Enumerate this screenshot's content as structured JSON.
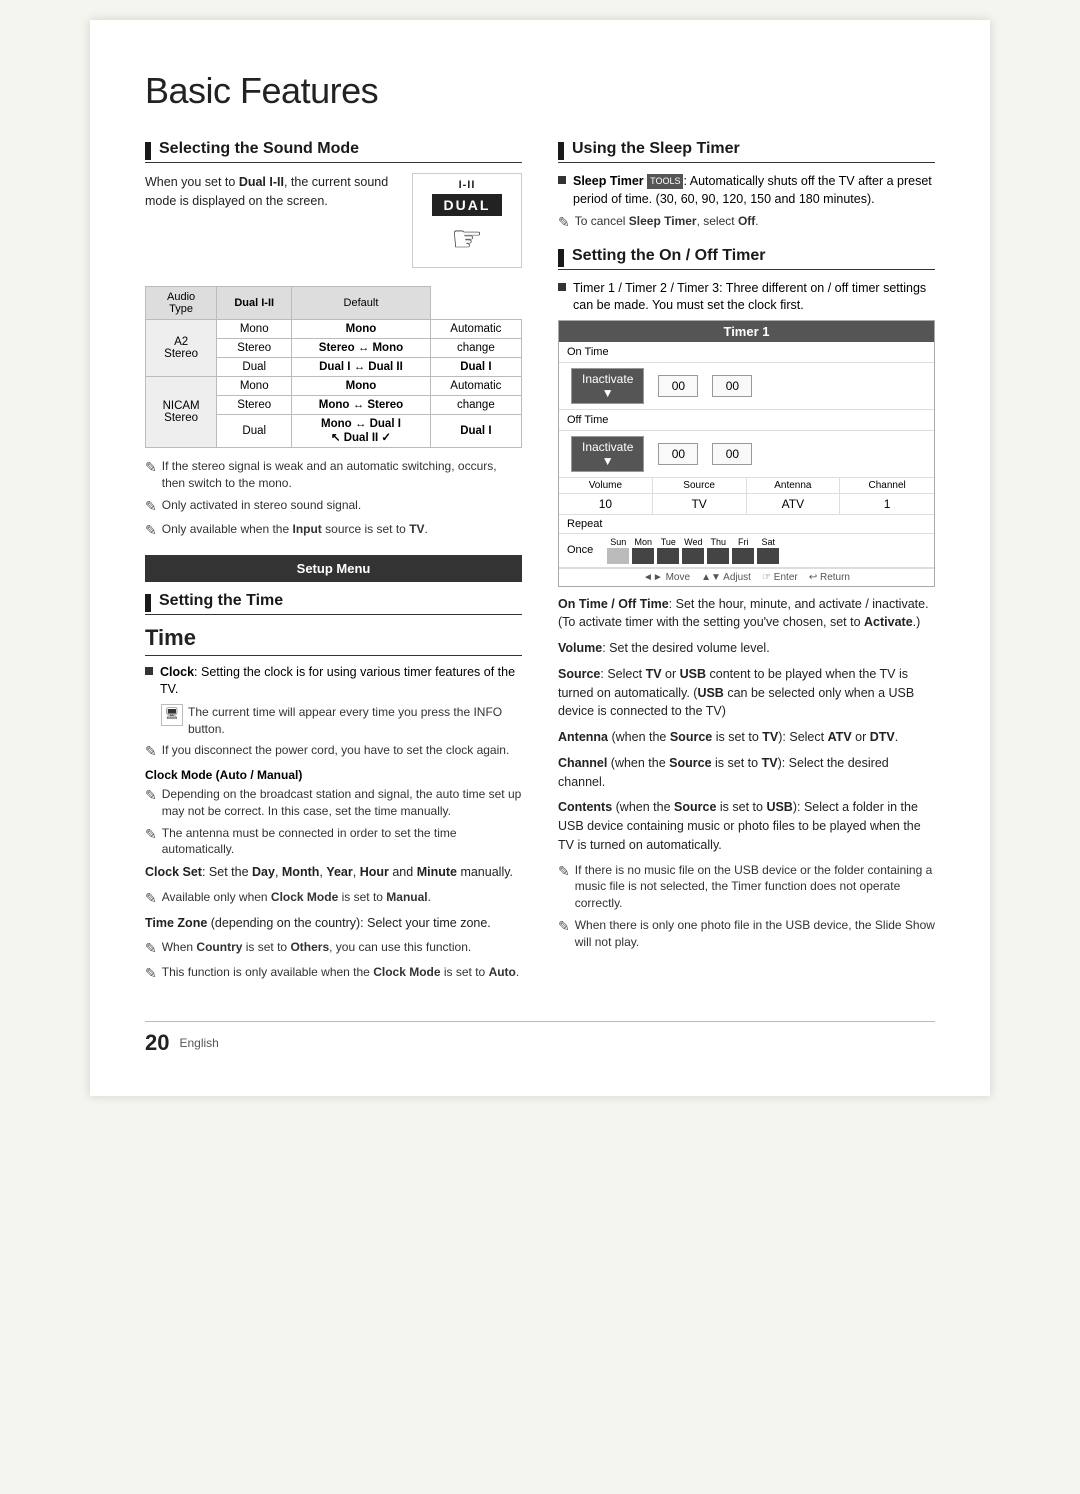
{
  "page": {
    "title": "Basic Features",
    "footer_number": "20",
    "footer_lang": "English"
  },
  "left_col": {
    "section1": {
      "title": "Selecting the Sound Mode",
      "intro": "When you set to Dual I-II, the current sound mode is displayed on the screen.",
      "dual_label": "I-II",
      "dual_box": "DUAL",
      "table": {
        "col_headers": [
          "Audio Type",
          "Dual I-II",
          "Default"
        ],
        "rows": [
          {
            "type_group": "A2 Stereo",
            "type": "Mono",
            "dual": "Mono",
            "default": "Automatic"
          },
          {
            "type_group": "",
            "type": "Stereo",
            "dual": "Stereo ↔ Mono",
            "default": "change"
          },
          {
            "type_group": "",
            "type": "Dual",
            "dual": "Dual I ↔ Dual II",
            "default": "Dual I"
          },
          {
            "type_group": "NICAM Stereo",
            "type": "Mono",
            "dual": "Mono",
            "default": "Automatic"
          },
          {
            "type_group": "",
            "type": "Stereo",
            "dual": "Mono ↔ Stereo",
            "default": "change"
          },
          {
            "type_group": "",
            "type": "Dual",
            "dual": "Mono ↔ Dual I ✓ Dual II ✓",
            "default": "Dual I"
          }
        ]
      },
      "notes": [
        "If the stereo signal is weak and an automatic switching, occurs, then switch to the mono.",
        "Only activated in stereo sound signal.",
        "Only available when the Input source is set to TV."
      ]
    },
    "setup_menu": "Setup Menu",
    "section2": {
      "title": "Setting the Time"
    },
    "time_section": {
      "title": "Time",
      "clock_bullet": "Clock: Setting the clock is for using various timer features of the TV.",
      "info_note": "The current time will appear every time you press the INFO button.",
      "note1": "If you disconnect the power cord, you have to set the clock again.",
      "clock_mode_header": "Clock Mode (Auto / Manual)",
      "note2": "Depending on the broadcast station and signal, the auto time set up may not be correct. In this case, set the time manually.",
      "note3": "The antenna must be connected in order to set the time automatically.",
      "clock_set": "Clock Set: Set the Day, Month, Year, Hour and Minute manually.",
      "note4": "Available only when Clock Mode is set to Manual.",
      "time_zone_text": "Time Zone (depending on the country): Select your time zone.",
      "note5": "When Country is set to Others, you can use this function.",
      "note6": "This function is only available when the Clock Mode is set to Auto."
    }
  },
  "right_col": {
    "section3": {
      "title": "Using the Sleep Timer",
      "bullet": "Sleep Timer",
      "tools": "TOOLS",
      "sleep_text": ": Automatically shuts off the TV after a preset period of time. (30, 60, 90, 120, 150 and 180 minutes).",
      "note1": "To cancel Sleep Timer, select Off."
    },
    "section4": {
      "title": "Setting the On / Off Timer",
      "bullet": "Timer 1 / Timer 2 / Timer 3: Three different on / off timer settings can be made. You must set the clock first.",
      "timer": {
        "header": "Timer 1",
        "on_time_label": "On Time",
        "on_inactivate": "Inactivate",
        "on_00_1": "00",
        "on_00_2": "00",
        "off_time_label": "Off Time",
        "off_inactivate": "Inactivate",
        "off_00_1": "00",
        "off_00_2": "00",
        "volume_label": "Volume",
        "volume_val": "10",
        "source_label": "Source",
        "source_val": "TV",
        "antenna_label": "Antenna",
        "antenna_val": "ATV",
        "channel_label": "Channel",
        "channel_val": "1",
        "repeat_label": "Repeat",
        "repeat_val": "Once",
        "days": [
          "Sun",
          "Mon",
          "Tue",
          "Wed",
          "Thu",
          "Fri",
          "Sat"
        ],
        "nav": "◄► Move   ▲▼ Adjust   ☞ Enter   ↩ Return"
      }
    },
    "descriptions": {
      "on_off_time": "On Time / Off Time: Set the hour, minute, and activate / inactivate. (To activate timer with the setting you've chosen, set to Activate.)",
      "volume": "Volume: Set the desired volume level.",
      "source": "Source: Select TV or USB content to be played when the TV is turned on automatically. (USB can be selected only when a USB device is connected to the TV)",
      "antenna": "Antenna (when the Source is set to TV): Select ATV or DTV.",
      "channel": "Channel (when the Source is set to TV): Select the desired channel.",
      "contents": "Contents (when the Source is set to USB): Select a folder in the USB device containing music or photo files to be played when the TV is turned on automatically.",
      "note1": "If there is no music file on the USB device or the folder containing a music file is not selected, the Timer function does not operate correctly.",
      "note2": "When there is only one photo file in the USB device, the Slide Show will not play."
    }
  }
}
